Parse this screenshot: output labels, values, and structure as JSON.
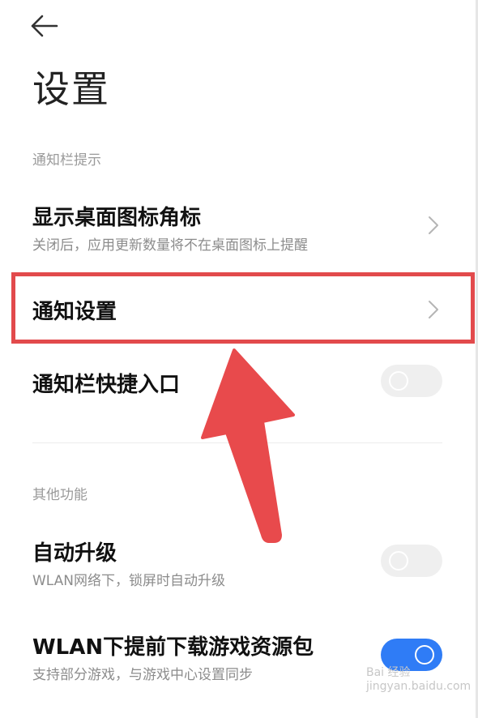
{
  "header": {
    "title": "设置"
  },
  "sections": {
    "notification": "通知栏提示",
    "other": "其他功能"
  },
  "rows": {
    "badge": {
      "title": "显示桌面图标角标",
      "sub": "关闭后，应用更新数量将不在桌面图标上提醒"
    },
    "notif_settings": {
      "title": "通知设置"
    },
    "quick_entry": {
      "title": "通知栏快捷入口",
      "toggle": "off"
    },
    "auto_update": {
      "title": "自动升级",
      "sub": "WLAN网络下，锁屏时自动升级",
      "toggle": "off"
    },
    "wlan_download": {
      "title": "WLAN下提前下载游戏资源包",
      "sub": "支持部分游戏，与游戏中心设置同步",
      "toggle": "on"
    }
  },
  "colors": {
    "accent": "#2f7cf6",
    "highlight": "#e24a4c"
  },
  "watermark": {
    "line1": "Bai 经验",
    "line2": "jingyan.baidu.com"
  }
}
